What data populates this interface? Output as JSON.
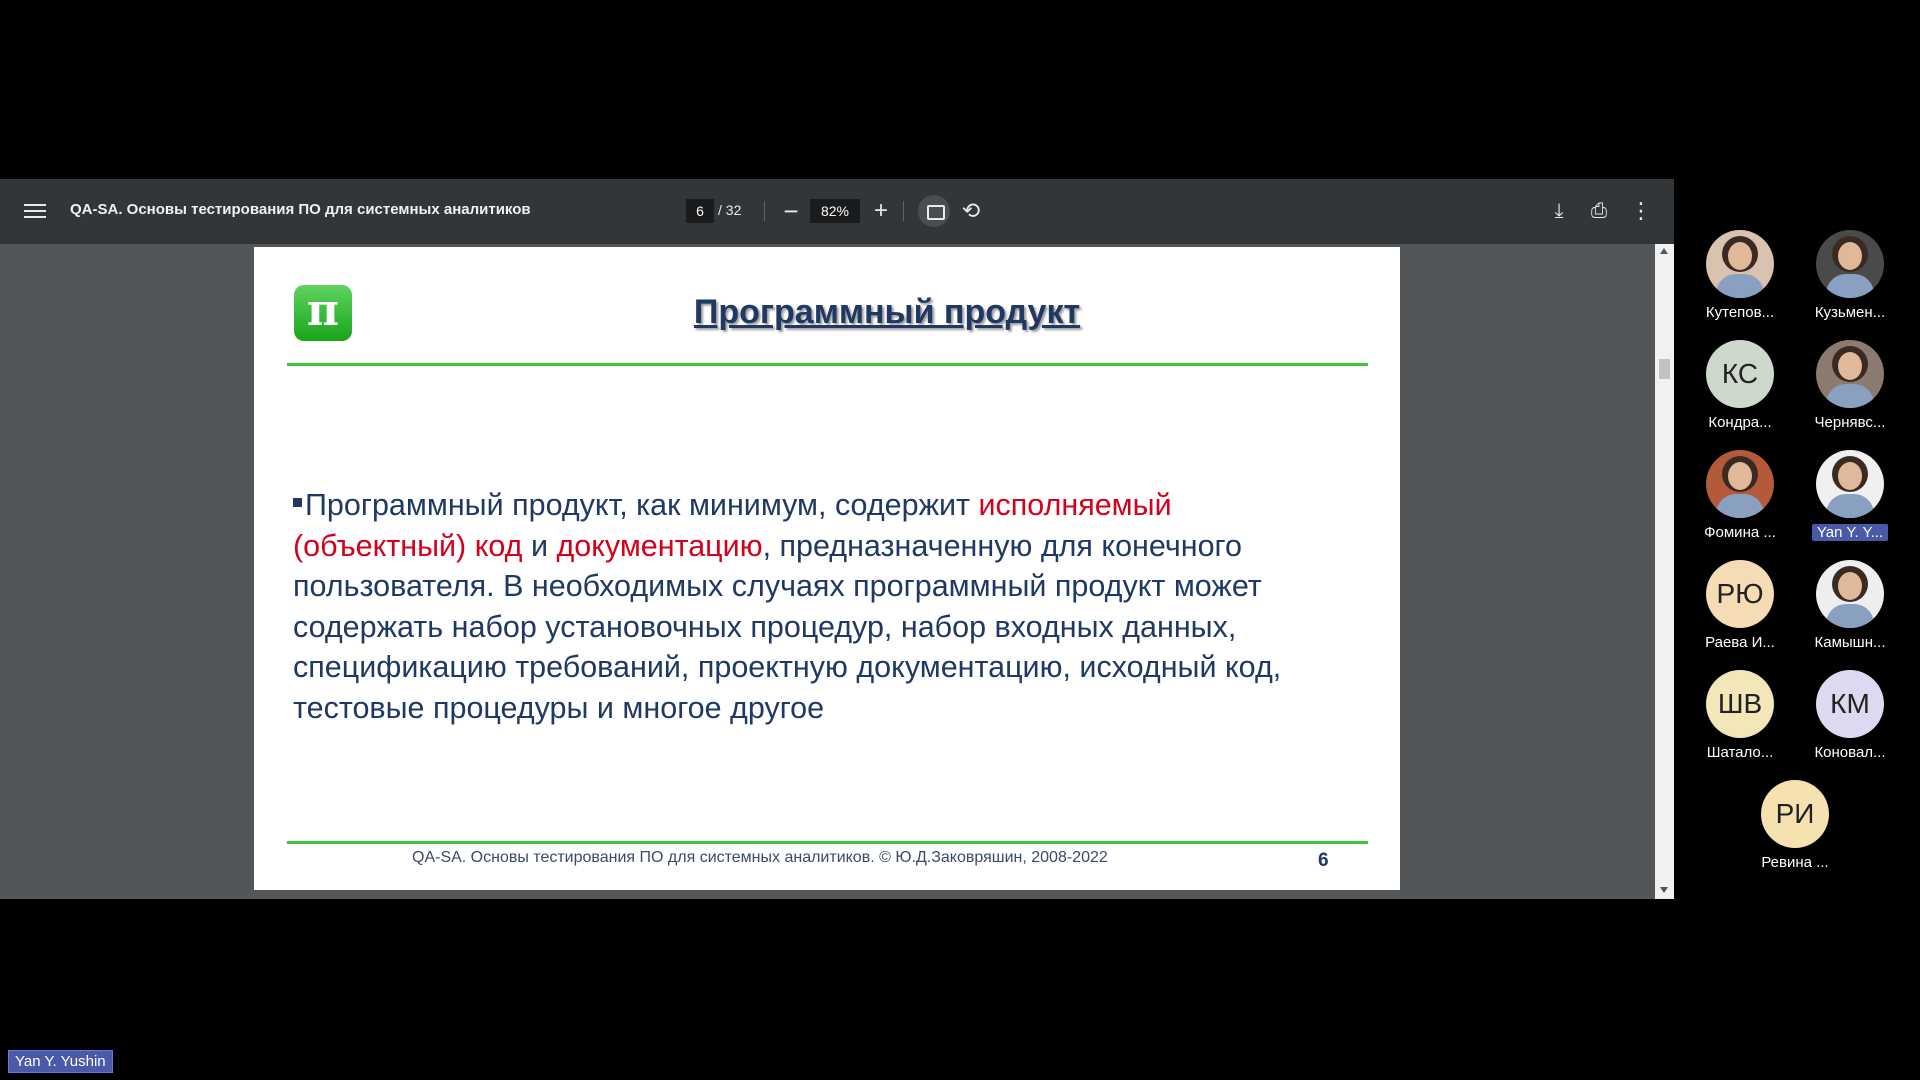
{
  "viewer": {
    "title": "QA-SA. Основы тестирования ПО для системных аналитиков",
    "page_current": "6",
    "page_total": "/ 32",
    "zoom": "82%",
    "icons": {
      "menu": "menu-icon",
      "zoom_out": "minus-icon",
      "zoom_in": "plus-icon",
      "fit": "fit-page-icon",
      "rotate": "rotate-icon",
      "download": "download-icon",
      "print": "print-icon",
      "more": "more-vert-icon"
    }
  },
  "slide": {
    "logo": "π",
    "title": "Программный продукт",
    "body": {
      "p1": "Программный продукт, как минимум, содержит ",
      "red1": "исполняемый (объектный) код",
      "p2": " и ",
      "red2": "документацию",
      "p3": ", предназначенную для конечного пользователя. В необходимых случаях программный продукт может содержать набор установочных процедур, набор входных данных, спецификацию требований, проектную документацию, исходный код, тестовые процедуры и многое другое"
    },
    "footer": "QA-SA. Основы тестирования ПО для системных аналитиков. © Ю.Д.Заковряшин, 2008-2022",
    "number": "6"
  },
  "participants": [
    {
      "name": "Кутепов...",
      "initials": "",
      "bg": "#d9c2b0"
    },
    {
      "name": "Кузьмен...",
      "initials": "",
      "bg": "#4a4a4a"
    },
    {
      "name": "Кондра...",
      "initials": "КС",
      "bg": "#cfd8cc"
    },
    {
      "name": "Чернявс...",
      "initials": "",
      "bg": "#8a7a70"
    },
    {
      "name": "Фомина ...",
      "initials": "",
      "bg": "#b35a3a"
    },
    {
      "name": "Yan Y. Y...",
      "initials": "",
      "bg": "#f0f0f0",
      "highlight": true
    },
    {
      "name": "Раева И...",
      "initials": "РЮ",
      "bg": "#f6dcb4"
    },
    {
      "name": "Камышн...",
      "initials": "",
      "bg": "#eeeeee"
    },
    {
      "name": "Шатало...",
      "initials": "ШВ",
      "bg": "#f3e6b8"
    },
    {
      "name": "Коновал...",
      "initials": "КМ",
      "bg": "#dcdaf0"
    },
    {
      "name": "Ревина ...",
      "initials": "РИ",
      "bg": "#f6e2b0"
    }
  ],
  "self_label": "Yan Y. Yushin"
}
